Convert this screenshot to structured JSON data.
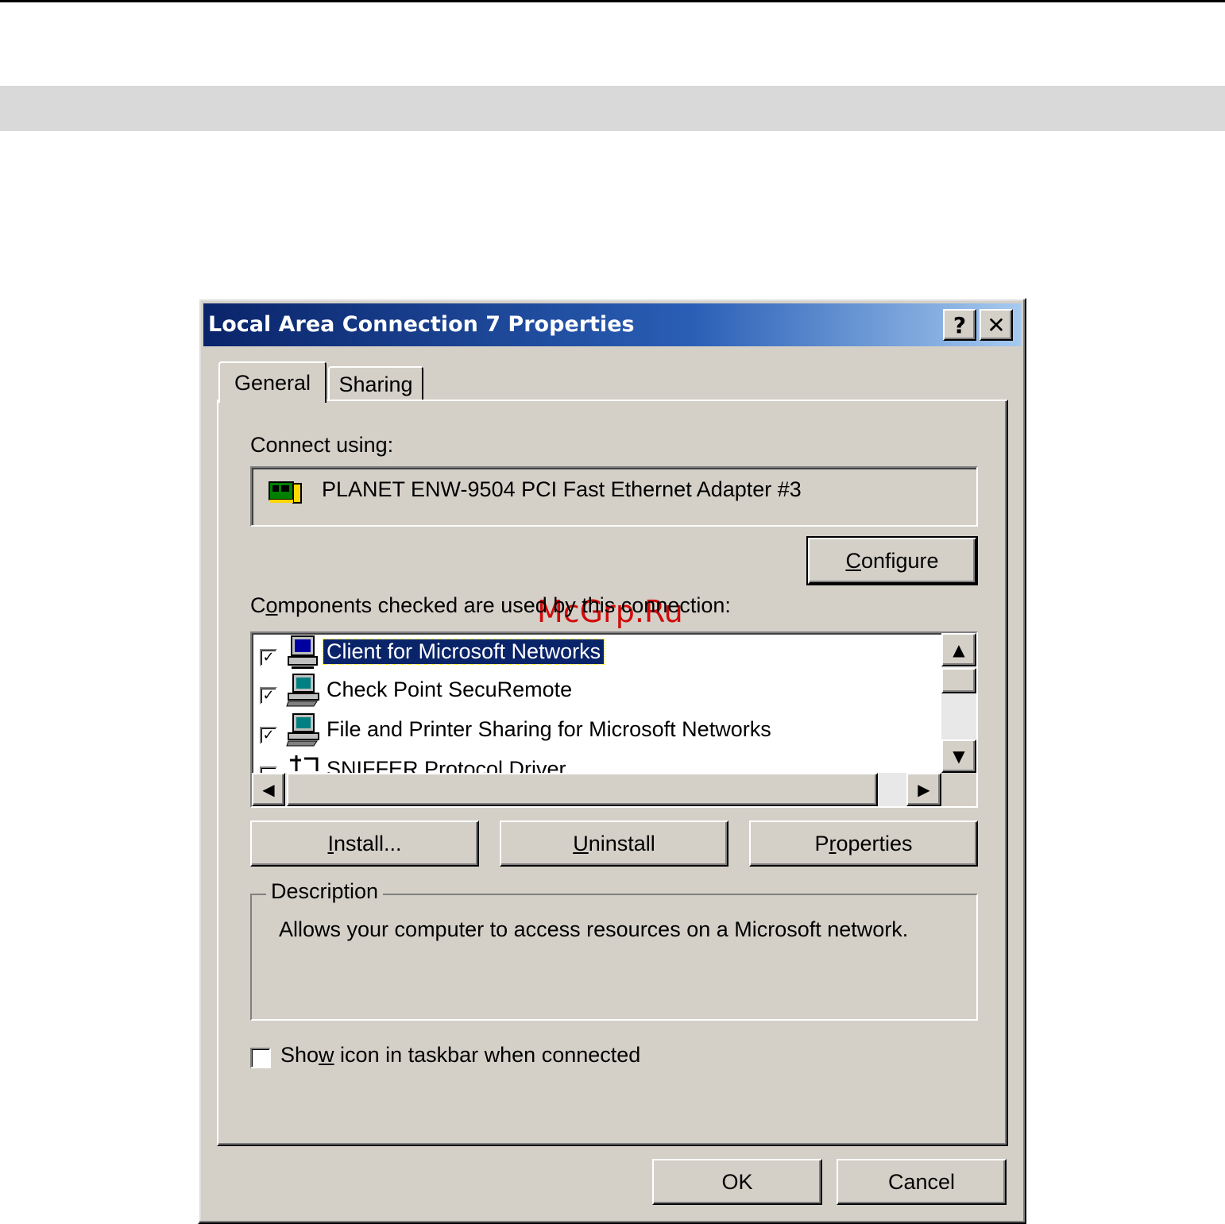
{
  "window": {
    "title": "Local Area Connection 7 Properties",
    "help_label": "?",
    "close_label": "✕"
  },
  "tabs": [
    {
      "label": "General",
      "active": true
    },
    {
      "label": "Sharing",
      "active": false
    }
  ],
  "general": {
    "connect_using_label": "Connect using:",
    "adapter_name": "PLANET ENW-9504 PCI Fast Ethernet Adapter #3",
    "adapter_icon": "network-card-icon",
    "configure_button": {
      "pre": "",
      "accel": "C",
      "post": "onfigure"
    },
    "components_label": {
      "pre": "C",
      "accel": "o",
      "post": "mponents checked are used by this connection:"
    },
    "components": [
      {
        "label": "Client for Microsoft Networks",
        "checked": true,
        "selected": true,
        "icon": "network-client-icon"
      },
      {
        "label": "Check Point SecuRemote",
        "checked": true,
        "selected": false,
        "icon": "network-service-icon"
      },
      {
        "label": "File and Printer Sharing for Microsoft Networks",
        "checked": true,
        "selected": false,
        "icon": "network-service-icon"
      },
      {
        "label": "SNIFFER Protocol Driver",
        "checked": false,
        "selected": false,
        "icon": "protocol-icon"
      }
    ],
    "install_button": {
      "pre": "",
      "accel": "I",
      "post": "nstall..."
    },
    "uninstall_button": {
      "pre": "",
      "accel": "U",
      "post": "ninstall"
    },
    "properties_button": {
      "pre": "P",
      "accel": "r",
      "post": "operties"
    },
    "description_label": "Description",
    "description_text": "Allows your computer to access resources on a Microsoft network.",
    "show_icon": {
      "pre": "Sho",
      "accel": "w",
      "post": " icon in taskbar when connected",
      "checked": false
    }
  },
  "footer": {
    "ok_label": "OK",
    "cancel_label": "Cancel"
  },
  "watermark": "McGrp.Ru",
  "colors": {
    "title_gradient_start": "#0a246a",
    "title_gradient_end": "#a6caf0",
    "face": "#d4d0c8",
    "selection": "#0a246a",
    "watermark": "#d00000"
  }
}
